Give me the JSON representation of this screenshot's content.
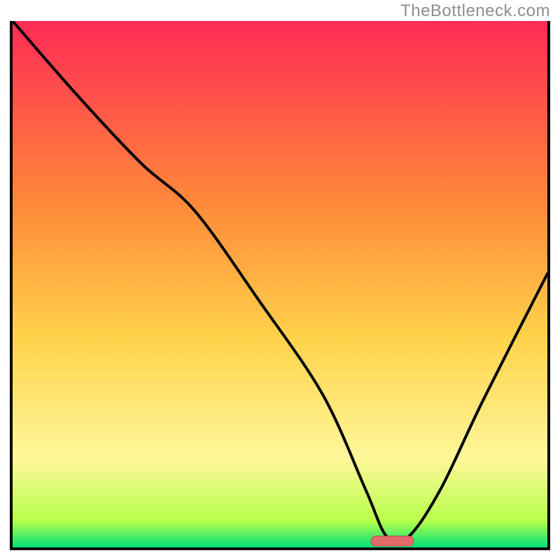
{
  "watermark": "TheBottleneck.com",
  "colors": {
    "grad_top": "#ff2a55",
    "grad_mid_upper": "#ff8a3a",
    "grad_mid": "#ffd24a",
    "grad_mid_lower": "#fff79a",
    "grad_lime": "#b6ff4a",
    "grad_green": "#00e07a",
    "curve": "#000000",
    "marker_fill": "#e36b6b",
    "marker_stroke": "#c74a4a"
  },
  "chart_data": {
    "type": "line",
    "title": "",
    "xlabel": "",
    "ylabel": "",
    "xlim": [
      0,
      100
    ],
    "ylim": [
      0,
      100
    ],
    "x": [
      0,
      12,
      24,
      34,
      46,
      58,
      66,
      70,
      74,
      80,
      88,
      100
    ],
    "values": [
      100,
      86,
      73,
      64,
      47,
      29,
      11,
      2,
      2,
      11,
      28,
      52
    ],
    "optimal_marker": {
      "x_start": 67,
      "x_end": 75,
      "y": 1.2
    }
  }
}
